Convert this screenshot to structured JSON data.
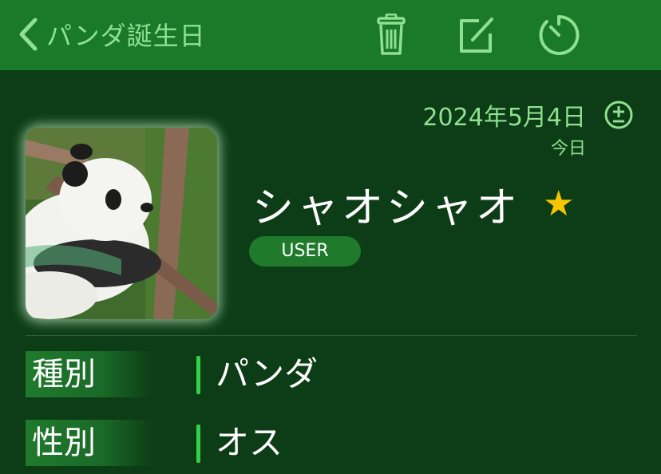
{
  "nav": {
    "back_label": "パンダ誕生日",
    "actions": [
      {
        "name": "trash-icon"
      },
      {
        "name": "edit-icon"
      },
      {
        "name": "timer-icon"
      }
    ]
  },
  "profile": {
    "date": "2024年5月4日",
    "date_sub": "今日",
    "date_adjust_icon": "plus-minus-icon",
    "photo_icon": "panda-photo",
    "name": "シャオシャオ",
    "favorite": "★",
    "badge": "USER"
  },
  "details": [
    {
      "label": "種別",
      "value": "パンダ"
    },
    {
      "label": "性別",
      "value": "オス"
    }
  ],
  "colors": {
    "navbar": "#1a7a2a",
    "background": "#0d3d16",
    "accent_text": "#8fe08f",
    "badge": "#1f7a2c",
    "star": "#f7c600",
    "value_bar": "#35d04a"
  }
}
